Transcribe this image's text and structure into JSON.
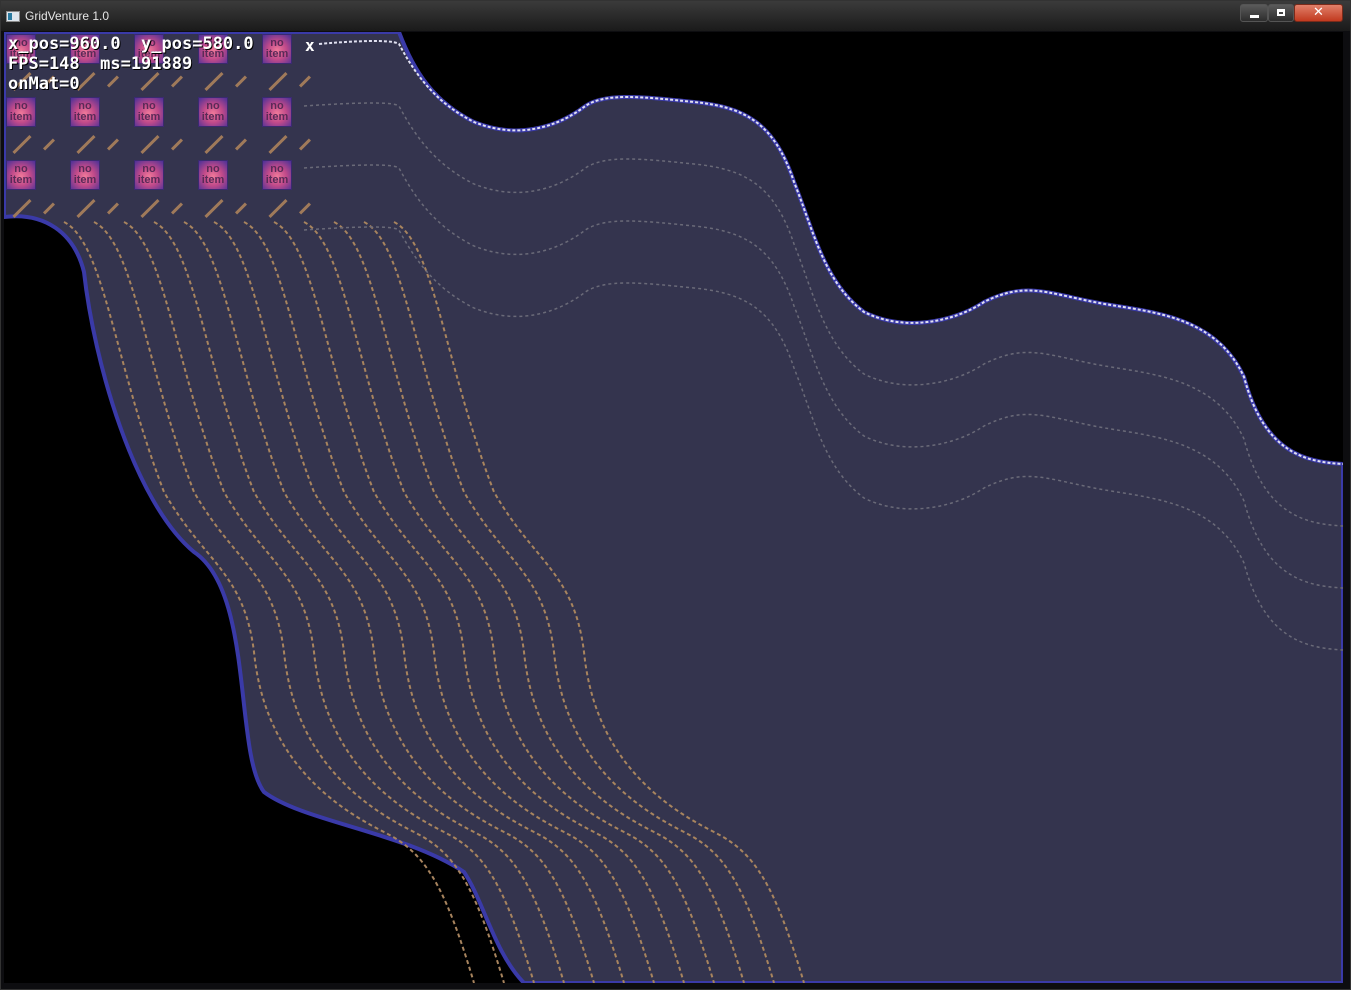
{
  "window": {
    "title": "GridVenture 1.0",
    "icon": "app-icon",
    "controls": {
      "minimize": "minimize-icon",
      "maximize": "maximize-icon",
      "close": "close-icon"
    },
    "close_glyph": "✕"
  },
  "hud": {
    "line1": "x_pos=960.0  y_pos=580.0",
    "line2": "FPS=148  ms=191889",
    "line3": "onMat=0",
    "close_label": "x"
  },
  "inventory": {
    "slot_label": "no\nitem",
    "row_a": [
      "no\nitem",
      "no\nitem",
      "no\nitem",
      "no\nitem",
      "no\nitem"
    ],
    "row_b": [
      "no\nitem",
      "no\nitem",
      "no\nitem",
      "no\nitem",
      "no\nitem"
    ],
    "row_c": [
      "no\nitem",
      "no\nitem",
      "no\nitem",
      "no\nitem",
      "no\nitem"
    ]
  },
  "colors": {
    "terrain": "#34344e",
    "terrain_edge": "#3a3aa8",
    "stripe_orange": "#a8845e",
    "stripe_grey": "#6a6a78",
    "background": "#000000"
  }
}
